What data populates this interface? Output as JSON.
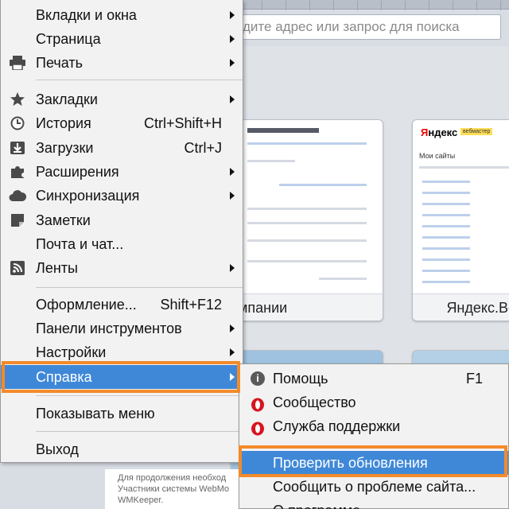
{
  "browser": {
    "address_placeholder": "дите адрес или запрос для поиска",
    "speed_dial": {
      "tile1_caption": "мпании",
      "tile2_caption": "Яндекс.Ве",
      "tile2_logo_red": "Я",
      "tile2_logo_rest": "ндекс",
      "tile2_badge": "вебмастер",
      "tile2_heading": "Мои сайты"
    },
    "bottom_text": [
      "Для продолжения необход",
      "Участники системы WebMo",
      "WMKeeper."
    ]
  },
  "main_menu": {
    "items": [
      {
        "label": "Вкладки и окна",
        "has_submenu": true
      },
      {
        "label": "Страница",
        "has_submenu": true
      },
      {
        "label": "Печать",
        "icon": "printer-icon",
        "has_submenu": true
      },
      {
        "label": "Закладки",
        "icon": "star-icon",
        "has_submenu": true
      },
      {
        "label": "История",
        "icon": "clock-icon",
        "shortcut": "Ctrl+Shift+H"
      },
      {
        "label": "Загрузки",
        "icon": "download-icon",
        "shortcut": "Ctrl+J"
      },
      {
        "label": "Расширения",
        "icon": "puzzle-icon",
        "has_submenu": true
      },
      {
        "label": "Синхронизация",
        "icon": "cloud-icon",
        "has_submenu": true
      },
      {
        "label": "Заметки",
        "icon": "note-icon"
      },
      {
        "label": "Почта и чат..."
      },
      {
        "label": "Ленты",
        "icon": "rss-icon",
        "has_submenu": true
      },
      {
        "label": "Оформление...",
        "shortcut": "Shift+F12"
      },
      {
        "label": "Панели инструментов",
        "has_submenu": true
      },
      {
        "label": "Настройки",
        "has_submenu": true
      },
      {
        "label": "Справка",
        "has_submenu": true,
        "active": true
      },
      {
        "label": "Показывать меню"
      },
      {
        "label": "Выход"
      }
    ]
  },
  "help_submenu": {
    "items": [
      {
        "label": "Помощь",
        "shortcut": "F1",
        "icon": "info-icon"
      },
      {
        "label": "Сообщество",
        "icon": "opera-icon"
      },
      {
        "label": "Служба поддержки",
        "icon": "opera-icon"
      },
      {
        "label": "Проверить обновления",
        "active": true
      },
      {
        "label": "Сообщить о проблеме сайта..."
      },
      {
        "label": "О программе"
      }
    ]
  },
  "colors": {
    "highlight": "#3f88d8",
    "annotation_box": "#f48a2a",
    "menu_bg": "#f2f2f2",
    "opera_red": "#d7141e",
    "info_gray": "#5a5a5a"
  }
}
